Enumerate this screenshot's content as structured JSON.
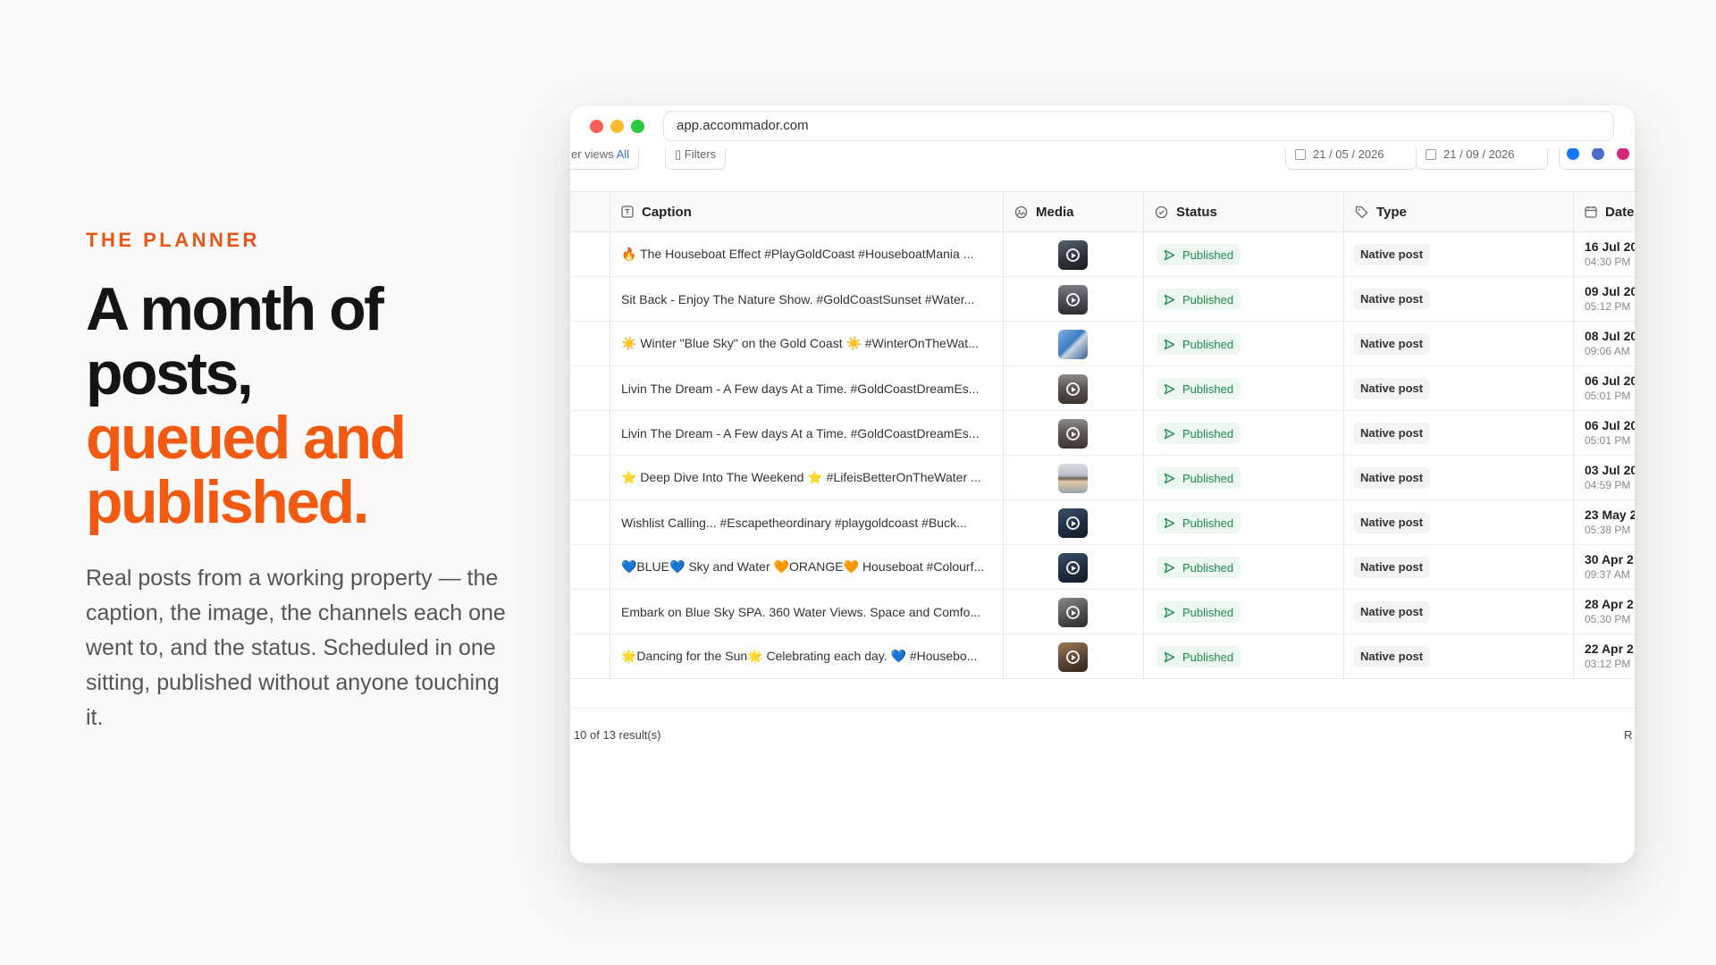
{
  "hero": {
    "eyebrow": "THE PLANNER",
    "headline_line1": "A month of",
    "headline_line2": "posts,",
    "headline_accent1": "queued and",
    "headline_accent2": "published.",
    "body": "Real posts from a working property — the caption, the image, the channels each one went to, and the status. Scheduled in one sitting, published without anyone touching it."
  },
  "browser": {
    "url": "app.accommador.com"
  },
  "toolbar": {
    "views_label": "er views",
    "views_value": "All",
    "filters_label": "Filters",
    "date_from": "21 / 05 / 2026",
    "date_to": "21 / 09 / 2026"
  },
  "table": {
    "columns": {
      "caption": "Caption",
      "media": "Media",
      "status": "Status",
      "type": "Type",
      "date": "Date"
    },
    "rows": [
      {
        "caption": "🔥 The Houseboat Effect #PlayGoldCoast #HouseboatMania ...",
        "status": "Published",
        "type": "Native post",
        "date": "16 Jul 20",
        "time": "04:30 PM",
        "thumb": "dark-video"
      },
      {
        "caption": "Sit Back - Enjoy The Nature Show. #GoldCoastSunset #Water...",
        "status": "Published",
        "type": "Native post",
        "date": "09 Jul 20",
        "time": "05:12 PM",
        "thumb": "dusk-video"
      },
      {
        "caption": "☀️ Winter \"Blue Sky\" on the Gold Coast ☀️ #WinterOnTheWat...",
        "status": "Published",
        "type": "Native post",
        "date": "08 Jul 20",
        "time": "09:06 AM",
        "thumb": "blue-sky"
      },
      {
        "caption": "Livin The Dream - A Few days At a Time. #GoldCoastDreamEs...",
        "status": "Published",
        "type": "Native post",
        "date": "06 Jul 20",
        "time": "05:01 PM",
        "thumb": "sunset-video"
      },
      {
        "caption": "Livin The Dream - A Few days At a Time. #GoldCoastDreamEs...",
        "status": "Published",
        "type": "Native post",
        "date": "06 Jul 20",
        "time": "05:01 PM",
        "thumb": "sunset-video"
      },
      {
        "caption": "⭐ Deep Dive Into The Weekend ⭐ #LifeisBetterOnTheWater ...",
        "status": "Published",
        "type": "Native post",
        "date": "03 Jul 20",
        "time": "04:59 PM",
        "thumb": "horizon"
      },
      {
        "caption": "Wishlist Calling... #Escapetheordinary #playgoldcoast #Buck...",
        "status": "Published",
        "type": "Native post",
        "date": "23 May 2",
        "time": "05:38 PM",
        "thumb": "navy-video"
      },
      {
        "caption": "💙BLUE💙 Sky and Water 🧡ORANGE🧡 Houseboat #Colourf...",
        "status": "Published",
        "type": "Native post",
        "date": "30 Apr 2",
        "time": "09:37 AM",
        "thumb": "navy-video"
      },
      {
        "caption": "Embark on Blue Sky SPA. 360 Water Views. Space and Comfo...",
        "status": "Published",
        "type": "Native post",
        "date": "28 Apr 2",
        "time": "05:30 PM",
        "thumb": "grey-video"
      },
      {
        "caption": "🌟Dancing for the Sun🌟 Celebrating each day. 💙 #Housebo...",
        "status": "Published",
        "type": "Native post",
        "date": "22 Apr 2",
        "time": "03:12 PM",
        "thumb": "warm-video"
      }
    ]
  },
  "footer": {
    "results": "› 10 of 13 result(s)",
    "rows_label": "R"
  },
  "colors": {
    "accent": "#f25a12",
    "published_green": "#1e8a4c",
    "published_bg": "#edf8f1"
  }
}
